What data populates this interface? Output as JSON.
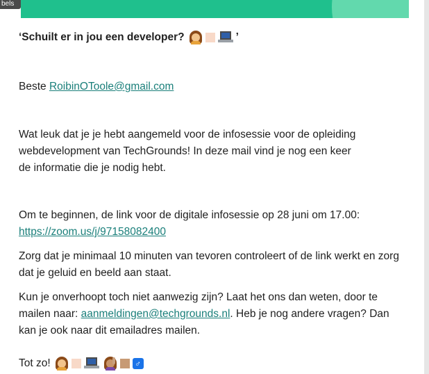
{
  "top_tag": "bels",
  "heading": {
    "text": "‘Schuilt er in jou een developer?",
    "tail": "’"
  },
  "greeting": {
    "prefix": "Beste ",
    "email": "RoibinOToole@gmail.com"
  },
  "intro": {
    "line1": "Wat leuk dat je je hebt aangemeld voor de infosessie voor de opleiding",
    "line2": "webdevelopment van TechGrounds! In deze mail vind je nog een keer",
    "line3": "de informatie die je nodig hebt."
  },
  "link_section": {
    "line1": "Om te beginnen, de link voor de digitale infosessie op 28 juni om 17.00:",
    "link": "https://zoom.us/j/97158082400"
  },
  "check_section": {
    "line1": "Zorg dat je minimaal 10 minuten van tevoren controleert of de link werkt en zorg",
    "line2": "dat je geluid en beeld aan staat."
  },
  "absent_section": {
    "line1": "Kun je onverhoopt toch niet aanwezig zijn? Laat het ons dan weten, door te",
    "line2_prefix": "mailen naar: ",
    "email": "aanmeldingen@techgrounds.nl",
    "line2_suffix": ". Heb je nog andere vragen? Dan",
    "line3": "kan je ook naar dit emailadres mailen."
  },
  "signoff": {
    "text": "Tot zo!",
    "male_symbol": "♂"
  },
  "icons": [
    "woman-technologist-icon",
    "laptop-icon",
    "woman-raising-hand-icon",
    "male-sign-icon"
  ],
  "colors": {
    "banner": "#1fc08d",
    "link": "#1a7f7a"
  }
}
